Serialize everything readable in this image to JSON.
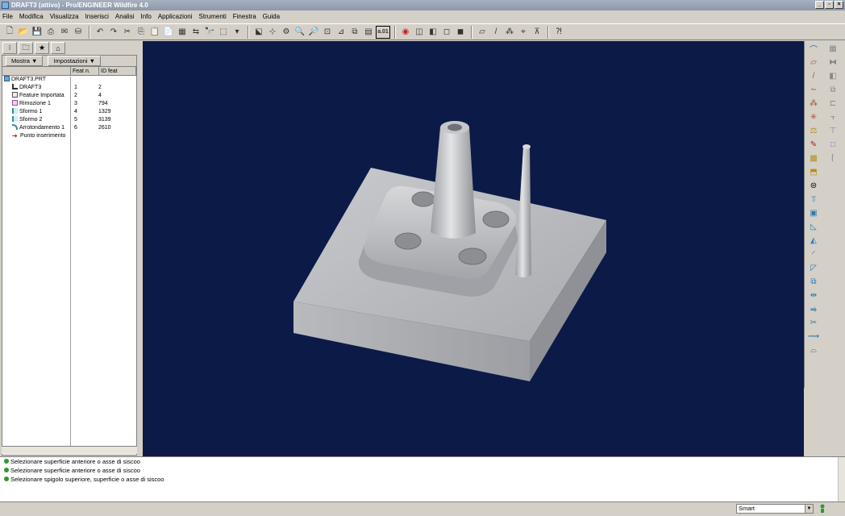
{
  "window": {
    "title": "DRAFT3 (attivo) - Pro/ENGINEER Wildfire 4.0"
  },
  "menu": [
    "File",
    "Modifica",
    "Visualizza",
    "Inserisci",
    "Analisi",
    "Info",
    "Applicazioni",
    "Strumenti",
    "Finestra",
    "Guida"
  ],
  "toolbar": {
    "regen_label": "a.01"
  },
  "model_tree": {
    "show_label": "Mostra ▼",
    "settings_label": "Impostazioni ▼",
    "columns": [
      "Feat n.",
      "ID feat"
    ],
    "root": "DRAFT3.PRT",
    "rows": [
      {
        "name": "DRAFT3",
        "num": "1",
        "id": "2"
      },
      {
        "name": "Feature Importata",
        "num": "2",
        "id": "4"
      },
      {
        "name": "Rimozione 1",
        "num": "3",
        "id": "794"
      },
      {
        "name": "Sformo 1",
        "num": "4",
        "id": "1329"
      },
      {
        "name": "Sformo 2",
        "num": "5",
        "id": "3139"
      },
      {
        "name": "Arrotondamento 1",
        "num": "6",
        "id": "2610"
      },
      {
        "name": "Punto inserimento",
        "num": "",
        "id": ""
      }
    ]
  },
  "messages": [
    "Selezionare superficie anteriore o asse di siscoo",
    "Selezionare superficie anteriore o asse di siscoo",
    "Selezionare spigolo superiore, superficie o asse di siscoo"
  ],
  "status": {
    "filter": "Smart"
  },
  "colors": {
    "viewport_bg": "#0c1a47",
    "model_grey": "#b4b6bb"
  }
}
